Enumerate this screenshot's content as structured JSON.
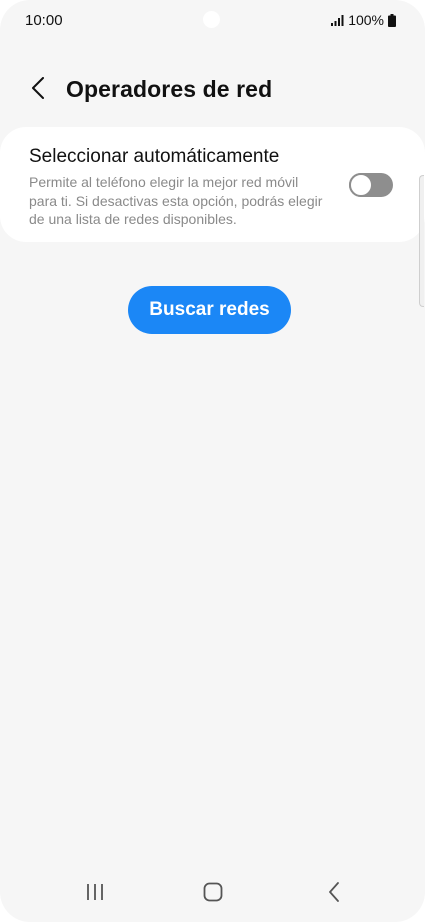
{
  "status_bar": {
    "time": "10:00",
    "battery": "100%",
    "icons": [
      "signal-icon",
      "battery-icon"
    ]
  },
  "header": {
    "back_icon": "chevron-left-icon",
    "title": "Operadores de red"
  },
  "settings": {
    "auto_select": {
      "title": "Seleccionar automáticamente",
      "description": "Permite al teléfono elegir la mejor red móvil para ti. Si desactivas esta opción, podrás elegir de una lista de redes disponibles.",
      "enabled": false
    }
  },
  "search_button": {
    "label": "Buscar redes"
  },
  "colors": {
    "accent": "#1b87f6",
    "background": "#f6f6f6",
    "card": "#ffffff",
    "toggle_off": "#8e8e8e"
  },
  "nav_bar": {
    "icons": [
      "recents-icon",
      "home-icon",
      "back-icon"
    ]
  }
}
